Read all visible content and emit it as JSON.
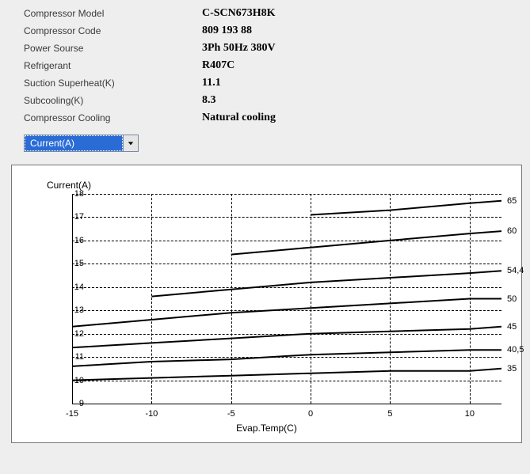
{
  "specs": {
    "model": {
      "label": "Compressor Model",
      "value": "C-SCN673H8K"
    },
    "code": {
      "label": "Compressor Code",
      "value": "809 193 88"
    },
    "power": {
      "label": "Power Sourse",
      "value": "3Ph  50Hz  380V"
    },
    "refrigerant": {
      "label": "Refrigerant",
      "value": "R407C"
    },
    "superheat": {
      "label": "Suction Superheat(K)",
      "value": "11.1"
    },
    "subcooling": {
      "label": "Subcooling(K)",
      "value": "8.3"
    },
    "cooling": {
      "label": "Compressor Cooling",
      "value": "Natural cooling"
    }
  },
  "dropdown": {
    "selected": "Current(A)"
  },
  "chart_data": {
    "type": "line",
    "title": "",
    "xlabel": "Evap.Temp(C)",
    "ylabel": "Current(A)",
    "xlim": [
      -15,
      12
    ],
    "ylim": [
      9,
      18
    ],
    "xticks": [
      -15,
      -10,
      -5,
      0,
      5,
      10
    ],
    "yticks": [
      9,
      10,
      11,
      12,
      13,
      14,
      15,
      16,
      17,
      18
    ],
    "x": [
      -15,
      -10,
      -5,
      0,
      5,
      10,
      12
    ],
    "series": [
      {
        "name": "65",
        "x": [
          0,
          5,
          10,
          12
        ],
        "values": [
          17.1,
          17.3,
          17.6,
          17.7
        ]
      },
      {
        "name": "60",
        "x": [
          -5,
          0,
          5,
          10,
          12
        ],
        "values": [
          15.4,
          15.7,
          16.0,
          16.3,
          16.4
        ]
      },
      {
        "name": "54,4",
        "x": [
          -10,
          -5,
          0,
          5,
          10,
          12
        ],
        "values": [
          13.6,
          13.9,
          14.2,
          14.4,
          14.6,
          14.7
        ]
      },
      {
        "name": "50",
        "x": [
          -15,
          -10,
          -5,
          0,
          5,
          10,
          12
        ],
        "values": [
          12.3,
          12.6,
          12.9,
          13.1,
          13.3,
          13.5,
          13.5
        ]
      },
      {
        "name": "45",
        "x": [
          -15,
          -10,
          -5,
          0,
          5,
          10,
          12
        ],
        "values": [
          11.4,
          11.6,
          11.8,
          12.0,
          12.1,
          12.2,
          12.3
        ]
      },
      {
        "name": "40,5",
        "x": [
          -15,
          -10,
          -5,
          0,
          5,
          10,
          12
        ],
        "values": [
          10.6,
          10.8,
          10.9,
          11.1,
          11.2,
          11.3,
          11.3
        ]
      },
      {
        "name": "35",
        "x": [
          -15,
          -10,
          -5,
          0,
          5,
          10,
          12
        ],
        "values": [
          10.0,
          10.1,
          10.2,
          10.3,
          10.4,
          10.4,
          10.5
        ]
      }
    ],
    "right_labels": [
      "65",
      "60",
      "54,4",
      "50",
      "45",
      "40,5",
      "35"
    ]
  }
}
